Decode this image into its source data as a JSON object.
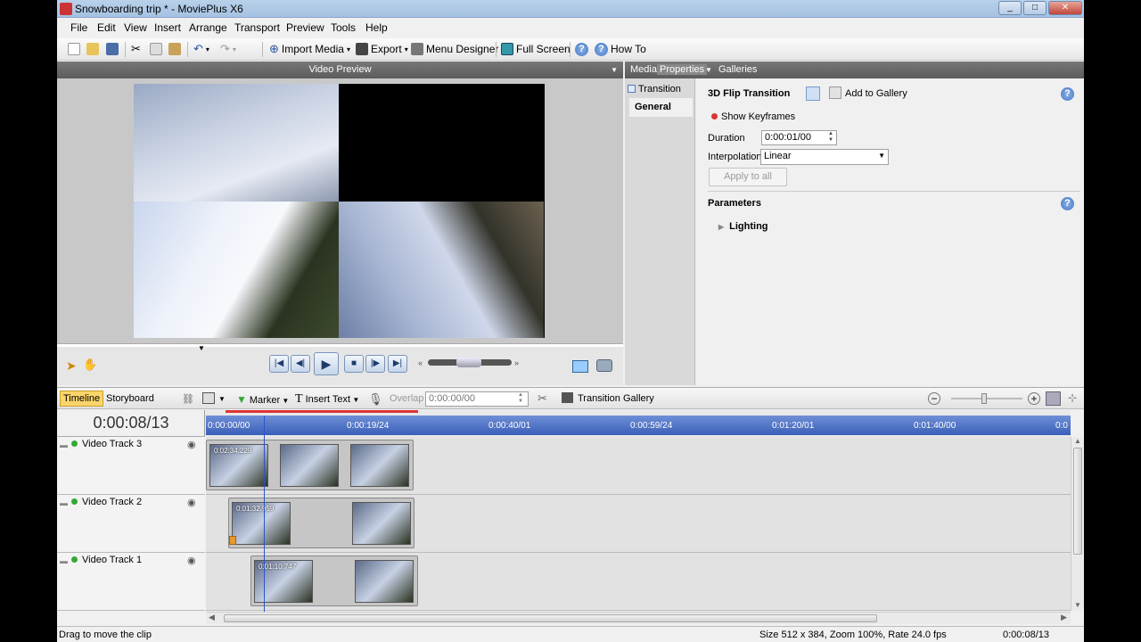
{
  "window": {
    "title": "Snowboarding trip * - MoviePlus X6"
  },
  "menu": [
    "File",
    "Edit",
    "View",
    "Insert",
    "Arrange",
    "Transport",
    "Preview",
    "Tools",
    "Help"
  ],
  "toolbar": {
    "import_label": "Import Media",
    "export_label": "Export",
    "menu_designer_label": "Menu Designer",
    "full_screen_label": "Full Screen",
    "how_to_label": "How To"
  },
  "video_preview": {
    "title": "Video Preview"
  },
  "panel_tabs": {
    "media": "Media",
    "properties": "Properties",
    "galleries": "Galleries"
  },
  "properties": {
    "left_items": [
      "Transition",
      "General"
    ],
    "heading": "3D Flip Transition",
    "add_gallery": "Add to Gallery",
    "show_keyframes": "Show Keyframes",
    "duration_label": "Duration",
    "duration_value": "0:00:01/00",
    "interp_label": "Interpolation",
    "interp_value": "Linear",
    "apply_all": "Apply to all",
    "parameters": "Parameters",
    "lighting": "Lighting"
  },
  "timeline_toolbar": {
    "timeline": "Timeline",
    "storyboard": "Storyboard",
    "marker": "Marker",
    "insert_text": "Insert Text",
    "overlap_label": "Overlap",
    "overlap_value": "0:00:00/00",
    "transition_gallery": "Transition Gallery"
  },
  "timeline": {
    "current_time": "0:00:08/13",
    "ruler_labels": [
      "0:00:00/00",
      "0:00:19/24",
      "0:00:40/01",
      "0:00:59/24",
      "0:01:20/01",
      "0:01:40/00",
      "0:0"
    ],
    "tracks": [
      {
        "name": "Video Track 3",
        "first_clip_label": "0:02:34.229"
      },
      {
        "name": "Video Track 2",
        "first_clip_label": "0:01:32.959"
      },
      {
        "name": "Video Track 1",
        "first_clip_label": "0:01:10.747"
      }
    ]
  },
  "status": {
    "hint": "Drag to move the clip",
    "info": "Size 512 x 384, Zoom 100%, Rate 24.0 fps",
    "time": "0:00:08/13"
  }
}
